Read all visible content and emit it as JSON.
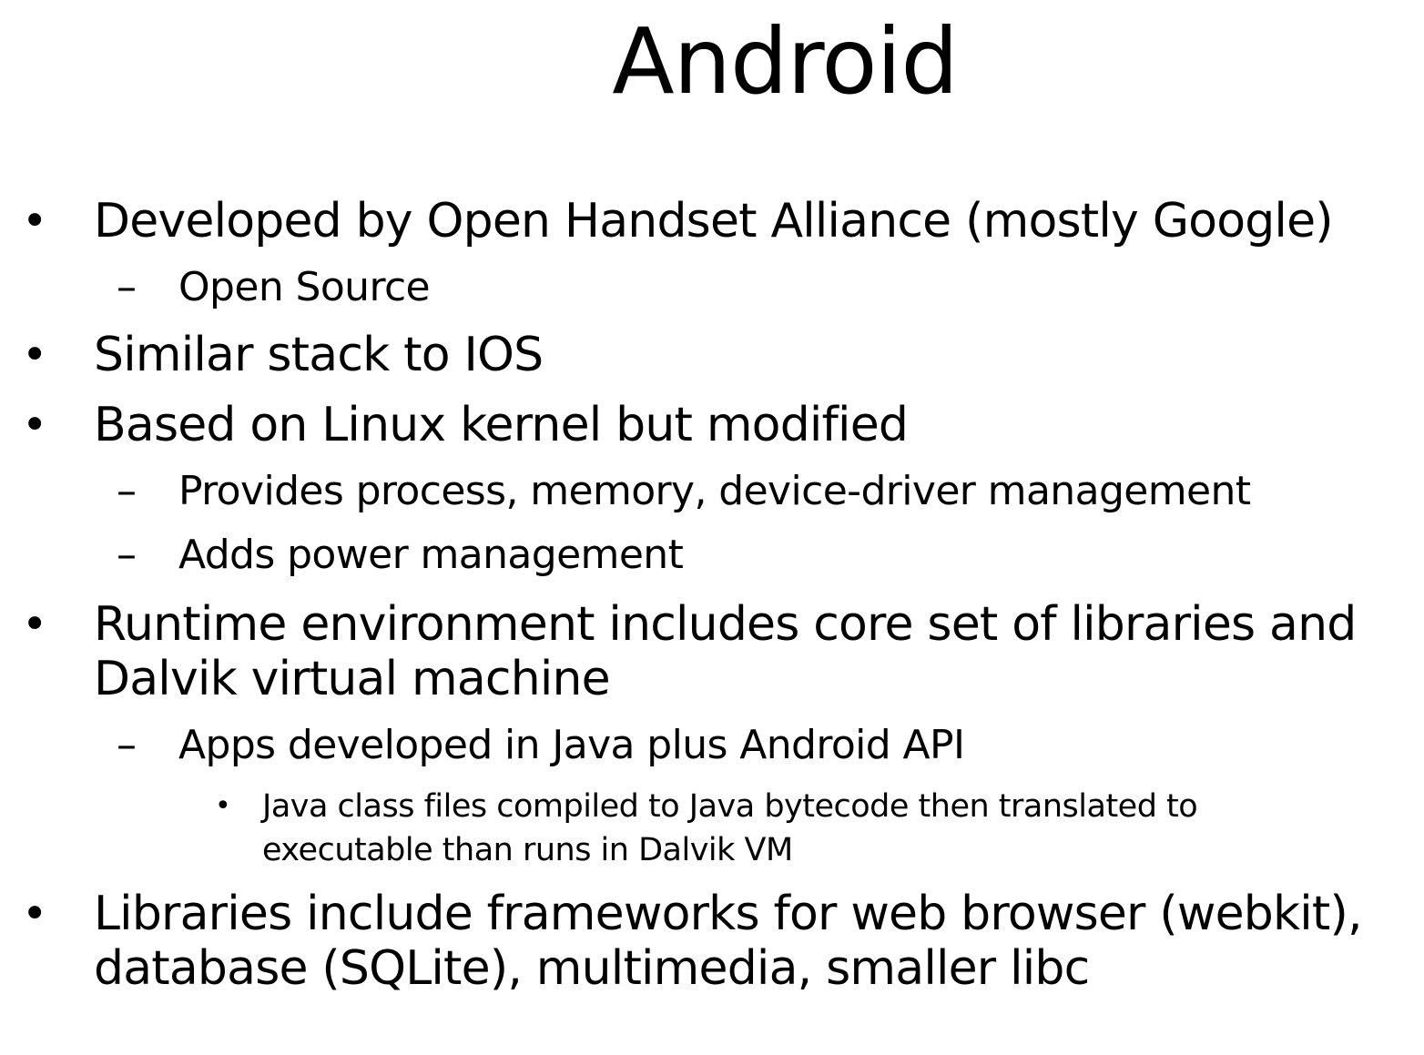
{
  "slide": {
    "title": "Android",
    "bullets": [
      {
        "level": 1,
        "marker": "•",
        "text": "Developed by Open Handset Alliance (mostly Google)"
      },
      {
        "level": 2,
        "marker": "–",
        "text": "Open Source"
      },
      {
        "level": 1,
        "marker": "•",
        "text": "Similar stack to IOS"
      },
      {
        "level": 1,
        "marker": "•",
        "text": "Based on Linux kernel but modified"
      },
      {
        "level": 2,
        "marker": "–",
        "text": "Provides process, memory, device-driver management"
      },
      {
        "level": 2,
        "marker": "–",
        "text": "Adds power management"
      },
      {
        "level": 1,
        "marker": "•",
        "text": "Runtime environment includes core set of libraries and",
        "continuation": "Dalvik virtual machine"
      },
      {
        "level": 2,
        "marker": "–",
        "text": "Apps developed in Java plus Android API"
      },
      {
        "level": 3,
        "marker": "•",
        "text": "Java class files compiled to Java bytecode then translated to",
        "continuation": "executable than runs in Dalvik VM"
      },
      {
        "level": 1,
        "marker": "•",
        "text": "Libraries include frameworks for web browser (webkit),",
        "continuation": "database (SQLite), multimedia, smaller libc"
      }
    ]
  }
}
